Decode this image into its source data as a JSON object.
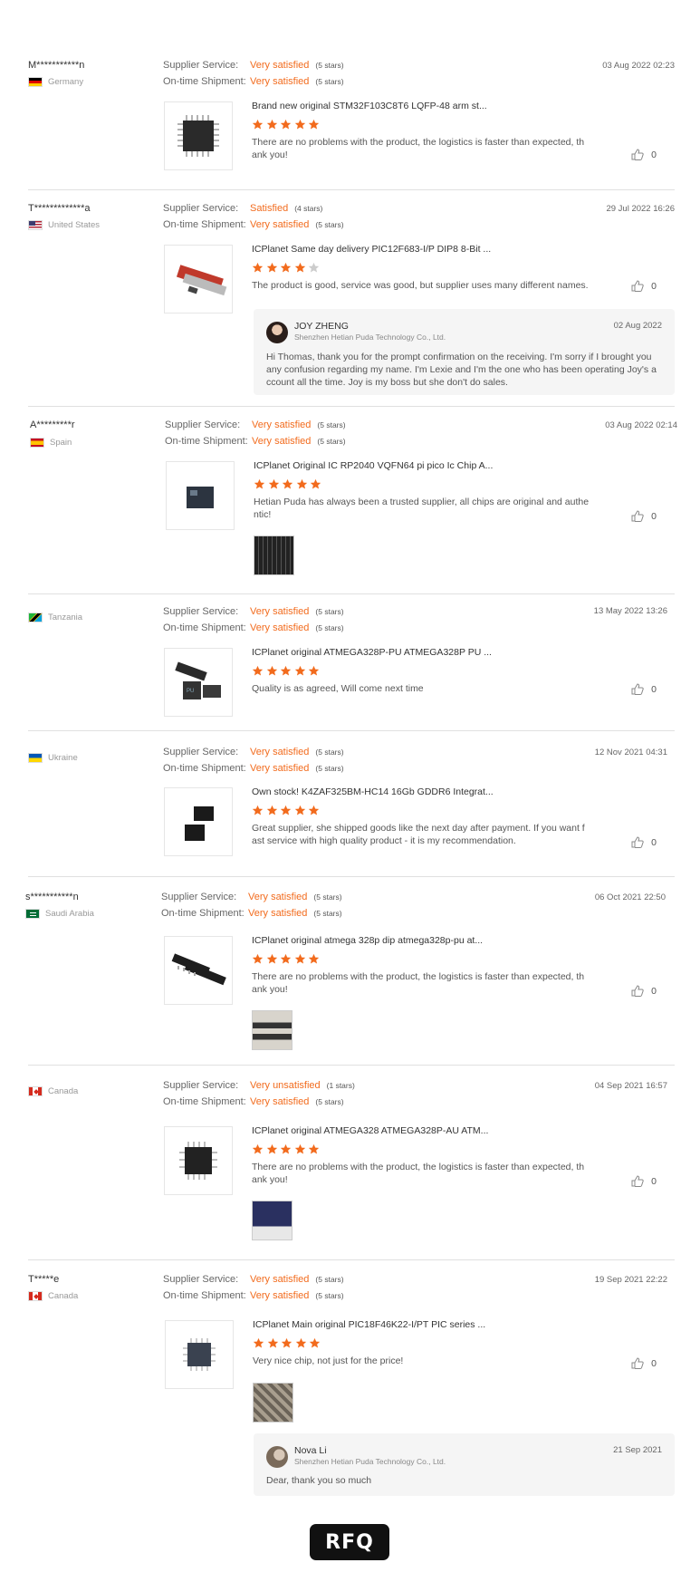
{
  "labels": {
    "supplier_service": "Supplier Service:",
    "on_time_shipment": "On-time Shipment:"
  },
  "reviews": [
    {
      "buyer": "M***********n",
      "country": "Germany",
      "flag": "germany-flag-icon",
      "service_value": "Very satisfied",
      "service_stars": "(5 stars)",
      "shipment_value": "Very satisfied",
      "shipment_stars": "(5 stars)",
      "date": "03 Aug 2022 02:23",
      "product": "Brand new original STM32F103C8T6 LQFP-48 arm st...",
      "rating": 5,
      "comment": "There are no problems with the product, the logistics is faster than expected, thank you!",
      "likes": "0"
    },
    {
      "buyer": "T*************a",
      "country": "United States",
      "flag": "usa-flag-icon",
      "service_value": "Satisfied",
      "service_stars": "(4 stars)",
      "shipment_value": "Very satisfied",
      "shipment_stars": "(5 stars)",
      "date": "29 Jul 2022 16:26",
      "product": "ICPlanet Same day delivery PIC12F683-I/P DIP8 8-Bit ...",
      "rating": 4,
      "comment": "The product is good, service was good, but supplier uses many different names.",
      "likes": "0",
      "reply": {
        "name": "JOY ZHENG",
        "company": "Shenzhen Hetian Puda Technology Co., Ltd.",
        "date": "02 Aug 2022",
        "text": "Hi Thomas, thank you for the prompt confirmation on the receiving. I'm sorry if I brought you any confusion regarding my name. I'm Lexie and I'm the one who has been operating Joy's account all the time. Joy is my boss but she don't do sales."
      }
    },
    {
      "buyer": "A*********r",
      "country": "Spain",
      "flag": "spain-flag-icon",
      "service_value": "Very satisfied",
      "service_stars": "(5 stars)",
      "shipment_value": "Very satisfied",
      "shipment_stars": "(5 stars)",
      "date": "03 Aug 2022 02:14",
      "product": "ICPlanet Original IC RP2040 VQFN64 pi pico Ic Chip A...",
      "rating": 5,
      "comment": "Hetian Puda has always been a trusted supplier, all chips are original and authentic!",
      "likes": "0"
    },
    {
      "buyer": "",
      "country": "Tanzania",
      "flag": "tanzania-flag-icon",
      "service_value": "Very satisfied",
      "service_stars": "(5 stars)",
      "shipment_value": "Very satisfied",
      "shipment_stars": "(5 stars)",
      "date": "13 May 2022 13:26",
      "product": "ICPlanet original ATMEGA328P-PU ATMEGA328P PU ...",
      "rating": 5,
      "comment": "Quality is as agreed, Will come next time",
      "likes": "0"
    },
    {
      "buyer": "",
      "country": "Ukraine",
      "flag": "ukraine-flag-icon",
      "service_value": "Very satisfied",
      "service_stars": "(5 stars)",
      "shipment_value": "Very satisfied",
      "shipment_stars": "(5 stars)",
      "date": "12 Nov 2021 04:31",
      "product": "Own stock! K4ZAF325BM-HC14 16Gb GDDR6 Integrat...",
      "rating": 5,
      "comment": "Great supplier, she shipped goods like the next day after payment. If you want fast service with high quality product - it is my recommendation.",
      "likes": "0"
    },
    {
      "buyer": "s***********n",
      "country": "Saudi Arabia",
      "flag": "saudi-arabia-flag-icon",
      "service_value": "Very satisfied",
      "service_stars": "(5 stars)",
      "shipment_value": "Very satisfied",
      "shipment_stars": "(5 stars)",
      "date": "06 Oct 2021 22:50",
      "product": "ICPlanet original atmega 328p dip atmega328p-pu at...",
      "rating": 5,
      "comment": "There are no problems with the product, the logistics is faster than expected, thank you!",
      "likes": "0"
    },
    {
      "buyer": "",
      "country": "Canada",
      "flag": "canada-flag-icon",
      "service_value": "Very unsatisfied",
      "service_stars": "(1 stars)",
      "shipment_value": "Very satisfied",
      "shipment_stars": "(5 stars)",
      "date": "04 Sep 2021 16:57",
      "product": "ICPlanet original ATMEGA328 ATMEGA328P-AU ATM...",
      "rating": 5,
      "comment": "There are no problems with the product, the logistics is faster than expected, thank you!",
      "likes": "0"
    },
    {
      "buyer": "T*****e",
      "country": "Canada",
      "flag": "canada-flag-icon",
      "service_value": "Very satisfied",
      "service_stars": "(5 stars)",
      "shipment_value": "Very satisfied",
      "shipment_stars": "(5 stars)",
      "date": "19 Sep 2021 22:22",
      "product": "ICPlanet Main original PIC18F46K22-I/PT PIC series ...",
      "rating": 5,
      "comment": "Very nice chip, not just for the price!",
      "likes": "0",
      "reply": {
        "name": "Nova Li",
        "company": "Shenzhen Hetian Puda Technology Co., Ltd.",
        "date": "21 Sep 2021",
        "text": "Dear, thank you so much"
      }
    }
  ],
  "rfq_button": "RFQ",
  "colors": {
    "accent": "#f26b1d",
    "star_empty": "#cccccc",
    "divider": "#e0e0e0"
  }
}
